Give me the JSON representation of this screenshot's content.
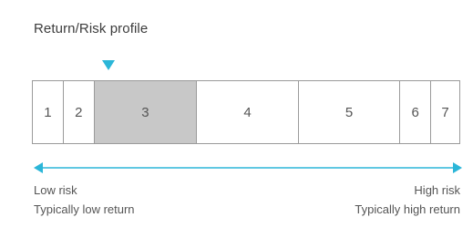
{
  "title": "Return/Risk profile",
  "scale": {
    "selected_value": "3",
    "cells": [
      "1",
      "2",
      "3",
      "4",
      "5",
      "6",
      "7"
    ]
  },
  "labels": {
    "low_risk": "Low risk",
    "low_return": "Typically low return",
    "high_risk": "High risk",
    "high_return": "Typically high return"
  },
  "colors": {
    "accent": "#2bb6d8",
    "selected_cell": "#c8c8c8",
    "border": "#9a9a9a",
    "text": "#555555"
  }
}
